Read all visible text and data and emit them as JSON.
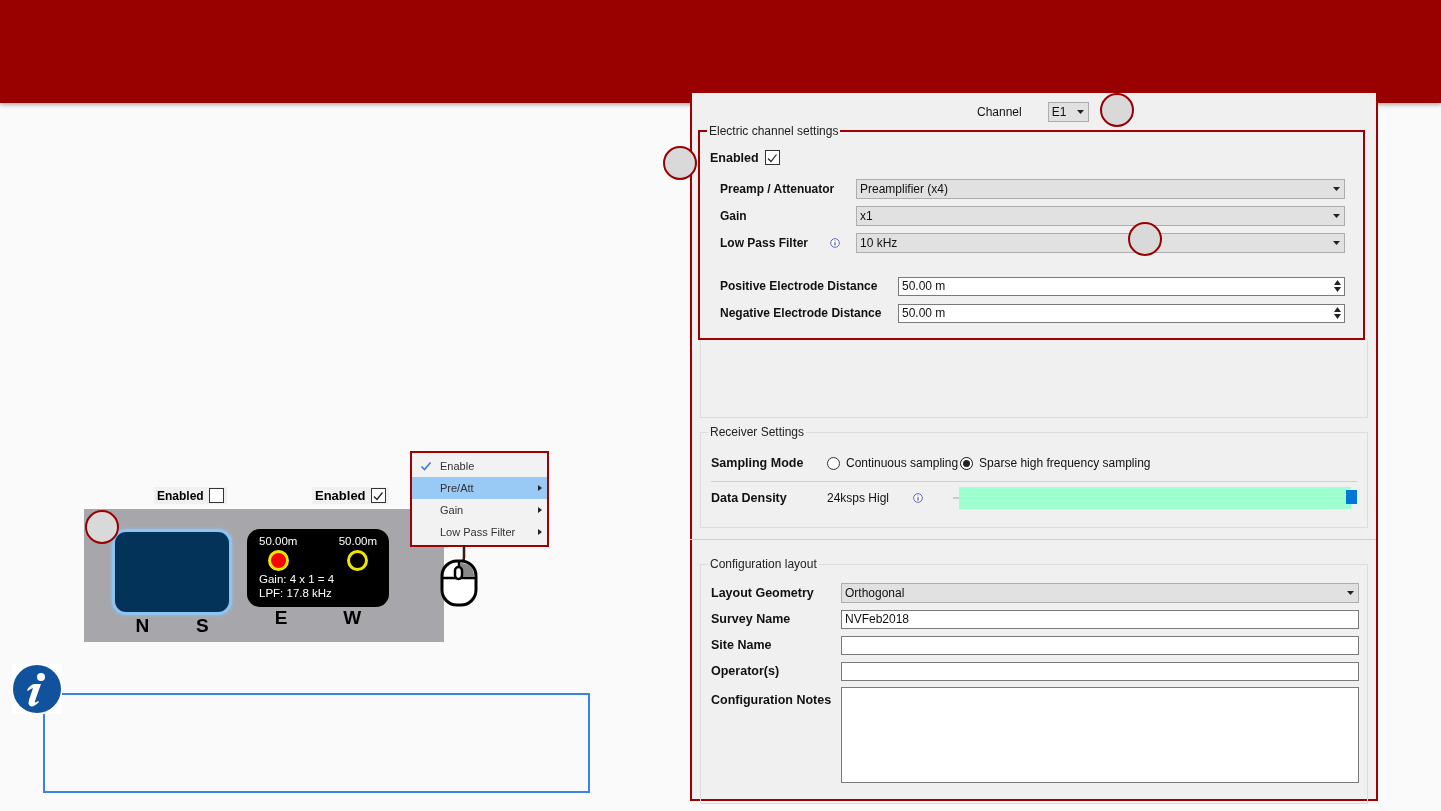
{
  "panel": {
    "channel": {
      "label": "Channel",
      "value": "E1"
    },
    "electric": {
      "title": "Electric channel settings",
      "enabled": {
        "label": "Enabled",
        "checked": true
      },
      "fields": [
        {
          "kind": "select",
          "label": "Preamp / Attenuator",
          "value": "Preamplifier (x4)"
        },
        {
          "kind": "select",
          "label": "Gain",
          "value": "x1"
        },
        {
          "kind": "select",
          "label": "Low Pass Filter",
          "value": "10 kHz",
          "info": true
        },
        {
          "kind": "spin",
          "label": "Positive Electrode Distance",
          "value": "50.00 m"
        },
        {
          "kind": "spin",
          "label": "Negative Electrode Distance",
          "value": "50.00 m"
        }
      ]
    },
    "receiver": {
      "title": "Receiver Settings",
      "sampling": {
        "label": "Sampling Mode",
        "options": [
          {
            "label": "Continuous sampling",
            "selected": false
          },
          {
            "label": "Sparse high frequency sampling",
            "selected": true
          }
        ]
      },
      "density": {
        "label": "Data Density",
        "reading": "24ksps Higl",
        "level": 1.0
      }
    },
    "config": {
      "title": "Configuration layout",
      "fields": [
        {
          "kind": "select",
          "label": "Layout Geometry",
          "value": "Orthogonal"
        },
        {
          "kind": "text",
          "label": "Survey Name",
          "value": "NVFeb2018"
        },
        {
          "kind": "text",
          "label": "Site Name"
        },
        {
          "kind": "text",
          "label": "Operator(s)"
        },
        {
          "kind": "notes",
          "label": "Configuration Notes"
        }
      ]
    }
  },
  "diagram": {
    "toggles": [
      {
        "label": "Enabled",
        "checked": false
      },
      {
        "label": "Enabled",
        "checked": true
      }
    ],
    "groups": [
      {
        "kind": "blank",
        "highlighted": true,
        "letters": [
          "N",
          "S"
        ]
      },
      {
        "kind": "detail",
        "highlighted": false,
        "letters": [
          "E",
          "W"
        ],
        "distances": [
          "50.00m",
          "50.00m"
        ],
        "electrodes": [
          {
            "active": true
          },
          {
            "active": false
          }
        ],
        "lines": [
          "Gain: 4 x 1 = 4",
          "LPF: 17.8 kHz"
        ]
      }
    ],
    "menu": [
      {
        "label": "Enable",
        "checked": true,
        "selected": false,
        "submenu": false
      },
      {
        "label": "Pre/Att",
        "checked": false,
        "selected": true,
        "submenu": true
      },
      {
        "label": "Gain",
        "checked": false,
        "selected": false,
        "submenu": true
      },
      {
        "label": "Low Pass Filter",
        "checked": false,
        "selected": false,
        "submenu": true
      }
    ]
  }
}
